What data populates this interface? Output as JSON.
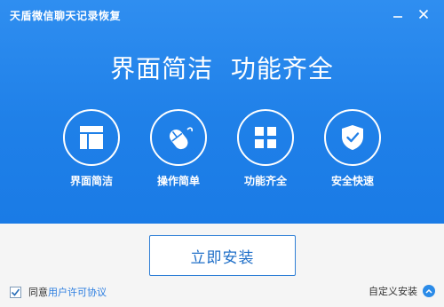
{
  "window": {
    "title": "天盾微信聊天记录恢复",
    "controls": [
      "minimize-icon",
      "close-icon"
    ]
  },
  "hero": {
    "headline": "界面简洁  功能齐全"
  },
  "features": [
    {
      "label": "界面简洁",
      "icon": "layout-icon"
    },
    {
      "label": "操作简单",
      "icon": "mouse-icon"
    },
    {
      "label": "功能齐全",
      "icon": "grid-icon"
    },
    {
      "label": "安全快速",
      "icon": "shield-check-icon"
    }
  ],
  "footer": {
    "install_label": "立即安装",
    "agree_label": "同意",
    "agree_checked": true,
    "license_link": "用户许可协议",
    "custom_install_label": "自定义安装"
  },
  "colors": {
    "primary_blue": "#1f80e8",
    "link_blue": "#2b7de0",
    "footer_bg": "#f5f5f5"
  }
}
